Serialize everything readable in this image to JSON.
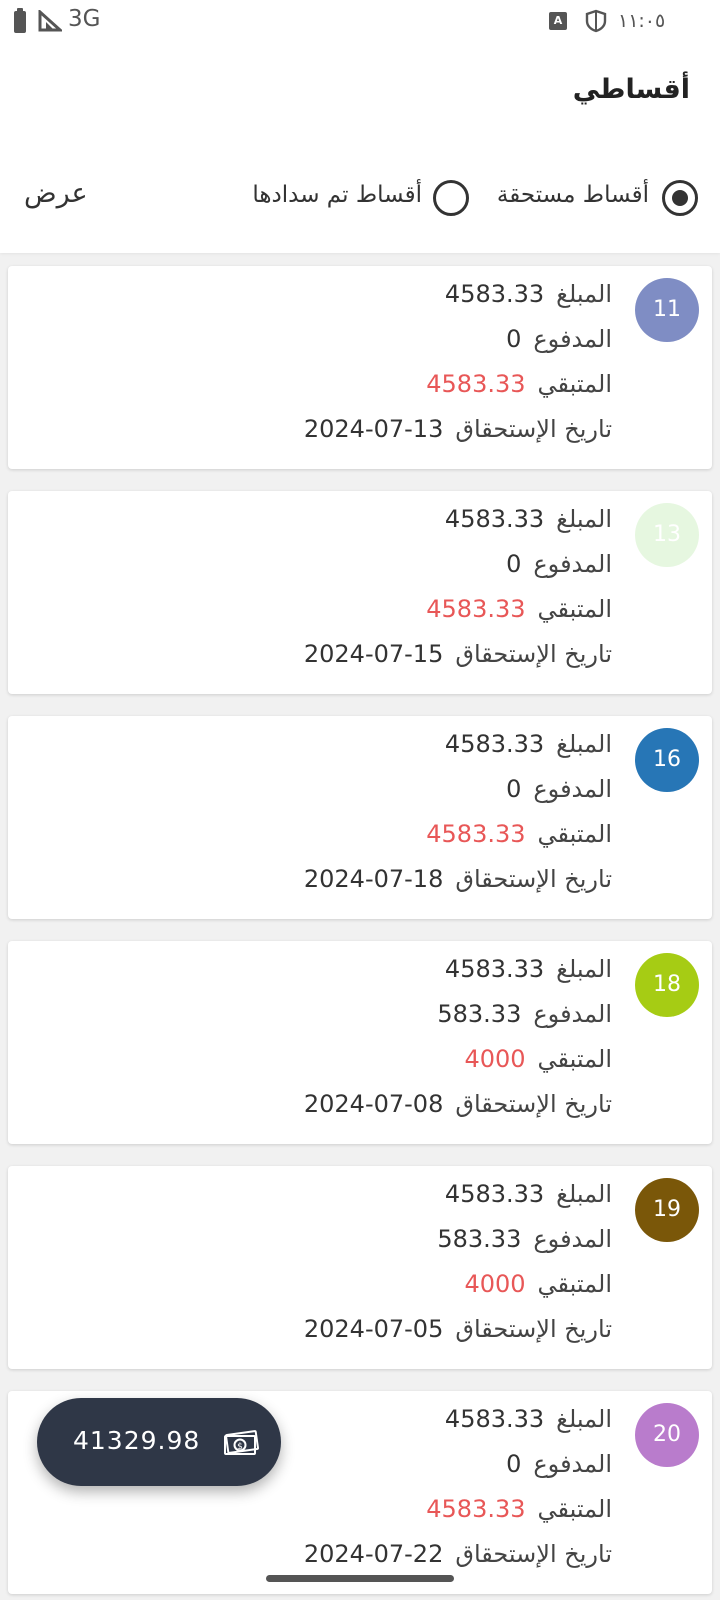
{
  "status_bar": {
    "network": "3G",
    "keyboard_glyph": "A",
    "time": "١١:٠٥"
  },
  "header": {
    "title": "أقساطي"
  },
  "filter": {
    "options": [
      {
        "label": "أقساط مستحقة",
        "selected": true
      },
      {
        "label": "أقساط تم سدادها",
        "selected": false
      }
    ],
    "view_label": "عرض"
  },
  "labels": {
    "amount": "المبلغ",
    "paid": "المدفوع",
    "remaining": "المتبقي",
    "due_date": "تاريخ الإستحقاق"
  },
  "installments": [
    {
      "number": "11",
      "color": "#7f8dc4",
      "amount": "4583.33",
      "paid": "0",
      "remaining": "4583.33",
      "due_date": "2024-07-13"
    },
    {
      "number": "13",
      "color": "#e6f7e0",
      "amount": "4583.33",
      "paid": "0",
      "remaining": "4583.33",
      "due_date": "2024-07-15"
    },
    {
      "number": "16",
      "color": "#2776b6",
      "amount": "4583.33",
      "paid": "0",
      "remaining": "4583.33",
      "due_date": "2024-07-18"
    },
    {
      "number": "18",
      "color": "#a6cc14",
      "amount": "4583.33",
      "paid": "583.33",
      "remaining": "4000",
      "due_date": "2024-07-08"
    },
    {
      "number": "19",
      "color": "#7a5709",
      "amount": "4583.33",
      "paid": "583.33",
      "remaining": "4000",
      "due_date": "2024-07-05"
    },
    {
      "number": "20",
      "color": "#b97ccc",
      "amount": "4583.33",
      "paid": "0",
      "remaining": "4583.33",
      "due_date": "2024-07-22"
    }
  ],
  "total": {
    "value": "41329.98",
    "icon": "money-icon"
  },
  "colors": {
    "remaining": "#e85757",
    "fab": "#2f3747"
  }
}
